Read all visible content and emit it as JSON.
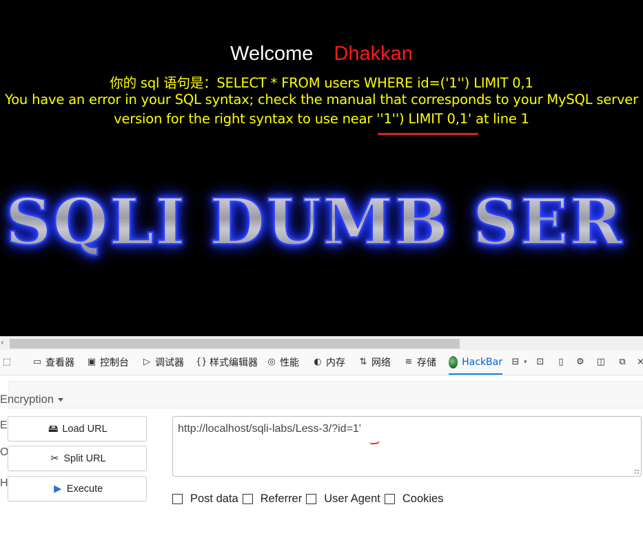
{
  "page": {
    "welcome": "Welcome",
    "username": "Dhakkan",
    "sql_line": "你的 sql 语句是：SELECT * FROM users WHERE id=('1'') LIMIT 0,1",
    "error_line1": "You have an error in your SQL syntax; check the manual that corresponds to your MySQL server",
    "error_line2": "version for the right syntax to use near ''1'') LIMIT 0,1' at line 1",
    "banner": "SQLI DUMB SER"
  },
  "devtools": {
    "tabs": [
      {
        "label": "查看器",
        "icon": "inspector-icon"
      },
      {
        "label": "控制台",
        "icon": "console-icon"
      },
      {
        "label": "调试器",
        "icon": "debugger-icon"
      },
      {
        "label": "样式编辑器",
        "icon": "style-editor-icon"
      },
      {
        "label": "性能",
        "icon": "performance-icon"
      },
      {
        "label": "内存",
        "icon": "memory-icon"
      },
      {
        "label": "网络",
        "icon": "network-icon"
      },
      {
        "label": "存储",
        "icon": "storage-icon"
      },
      {
        "label": "HackBar",
        "icon": "hackbar-icon",
        "active": true
      }
    ]
  },
  "hackbar": {
    "encryption_label": "Encryption",
    "side_letters": [
      "E",
      "O",
      "Ha"
    ],
    "load_url": "Load URL",
    "split_url": "Split URL",
    "execute": "Execute",
    "url": "http://localhost/sqli-labs/Less-3/?id=1'",
    "options": [
      "Post data",
      "Referrer",
      "User Agent",
      "Cookies"
    ]
  },
  "colors": {
    "page_bg": "#000000",
    "welcome": "#ffffff",
    "username": "#ff1a1a",
    "sql_text": "#ffff00",
    "annotation": "#e02020",
    "active_tab": "#0060df"
  }
}
